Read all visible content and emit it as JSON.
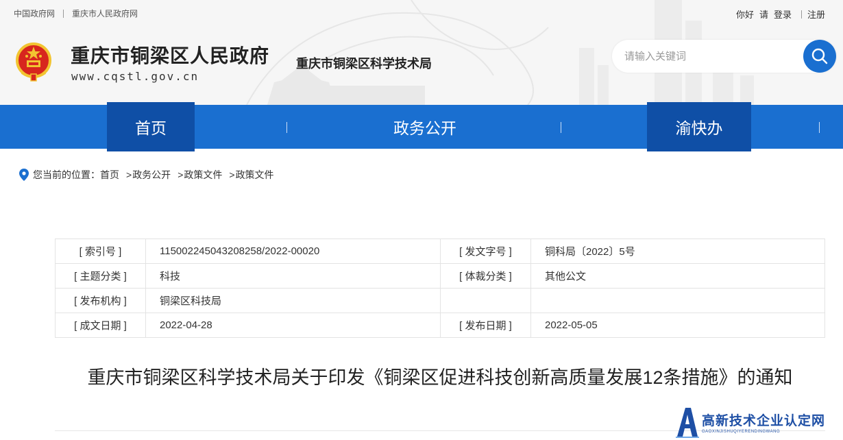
{
  "top_links": {
    "left": [
      "中国政府网",
      "重庆市人民政府网"
    ],
    "greeting": "你好",
    "please": "请",
    "login": "登录",
    "register": "注册"
  },
  "site": {
    "title": "重庆市铜梁区人民政府",
    "url": "www.cqstl.gov.cn",
    "department": "重庆市铜梁区科学技术局"
  },
  "search": {
    "placeholder": "请输入关键词",
    "value": ""
  },
  "nav": {
    "items": [
      "首页",
      "政务公开",
      "渝快办"
    ]
  },
  "breadcrumb": {
    "prefix": "您当前的位置：",
    "items": [
      "首页",
      "政务公开",
      "政策文件",
      "政策文件"
    ]
  },
  "meta": {
    "index_no_label": "[ 索引号 ]",
    "index_no": "115002245043208258/2022-00020",
    "doc_no_label": "[ 发文字号 ]",
    "doc_no": "铜科局〔2022〕5号",
    "topic_label": "[ 主题分类 ]",
    "topic": "科技",
    "genre_label": "[ 体裁分类 ]",
    "genre": "其他公文",
    "issuer_label": "[ 发布机构 ]",
    "issuer": "铜梁区科技局",
    "written_date_label": "[ 成文日期 ]",
    "written_date": "2022-04-28",
    "publish_date_label": "[ 发布日期 ]",
    "publish_date": "2022-05-05"
  },
  "document": {
    "title": "重庆市铜梁区科学技术局关于印发《铜梁区促进科技创新高质量发展12条措施》的通知"
  },
  "watermark": {
    "main": "高新技术企业认定网",
    "sub": "GAOXINJISHUQIYERENDINGWANG"
  },
  "colors": {
    "nav_bg": "#1a6fd0",
    "nav_active": "#0f4fa6",
    "search_button": "#1a6fd0",
    "emblem_red": "#d7261e",
    "emblem_gold": "#f2c431",
    "watermark_blue": "#1e4fa5"
  }
}
